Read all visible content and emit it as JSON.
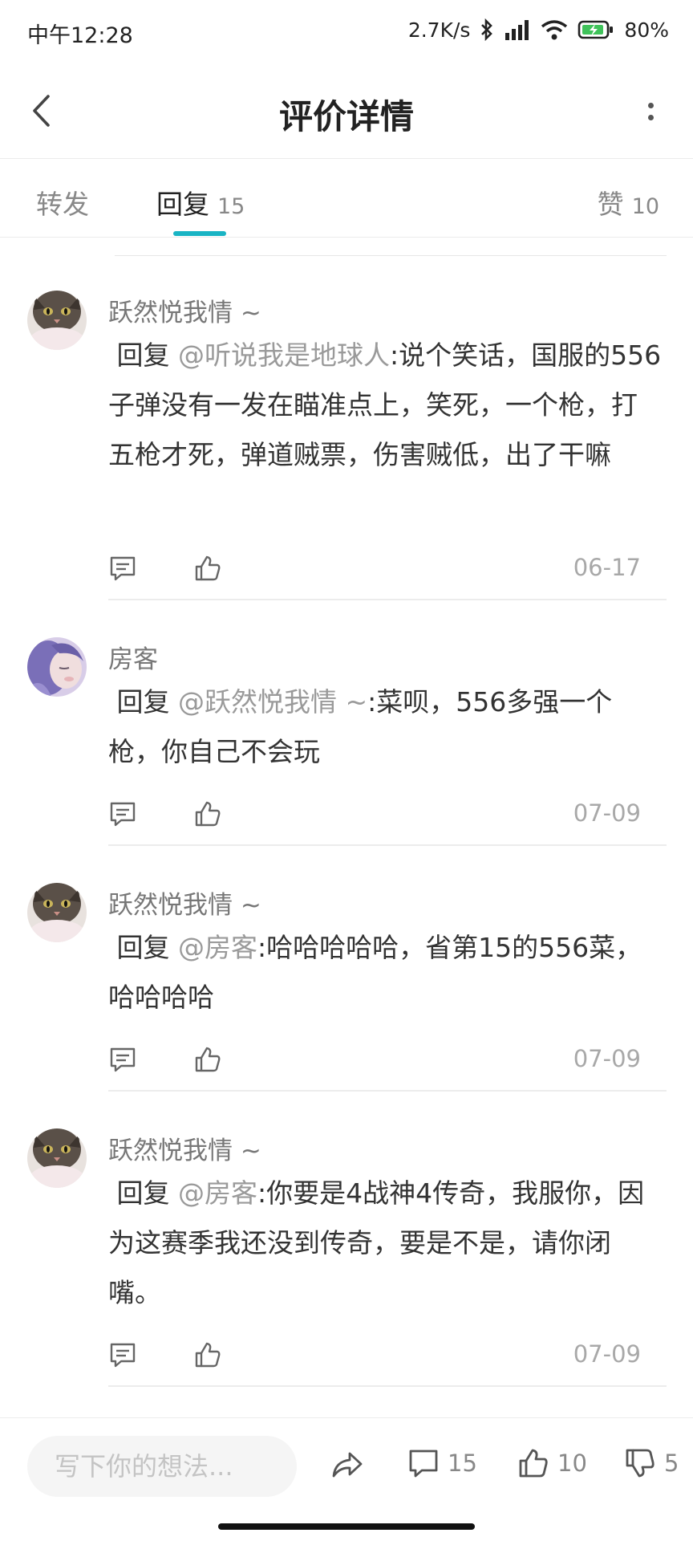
{
  "status_bar": {
    "time": "中午12:28",
    "net_speed": "2.7K/s",
    "battery": "80%"
  },
  "header": {
    "title": "评价详情"
  },
  "tabs": {
    "forward": {
      "label": "转发"
    },
    "reply": {
      "label": "回复",
      "count": "15"
    },
    "like": {
      "label": "赞",
      "count": "10"
    }
  },
  "comments": [
    {
      "name": "跃然悦我情 ~",
      "reply_prefix": "回复",
      "mention": "@听说我是地球人",
      "text": ":说个笑话，国服的556子弹没有一发在瞄准点上，笑死，一个枪，打五枪才死，弹道贼票，伤害贼低，出了干嘛",
      "date": "06-17"
    },
    {
      "name": "房客",
      "reply_prefix": "回复",
      "mention": "@跃然悦我情 ~",
      "text": ":菜呗，556多强一个枪，你自己不会玩",
      "date": "07-09"
    },
    {
      "name": "跃然悦我情 ~",
      "reply_prefix": "回复",
      "mention": "@房客",
      "text": ":哈哈哈哈哈，省第15的556菜，哈哈哈哈",
      "date": "07-09"
    },
    {
      "name": "跃然悦我情 ~",
      "reply_prefix": "回复",
      "mention": "@房客",
      "text": ":你要是4战神4传奇，我服你，因为这赛季我还没到传奇，要是不是，请你闭嘴。",
      "date": "07-09"
    }
  ],
  "bottom_bar": {
    "input_placeholder": "写下你的想法...",
    "comment_count": "15",
    "like_count": "10",
    "dislike_count": "5"
  },
  "colors": {
    "accent": "#19b4c4",
    "mention": "#9a9a9a",
    "muted": "#a8a8a8"
  }
}
